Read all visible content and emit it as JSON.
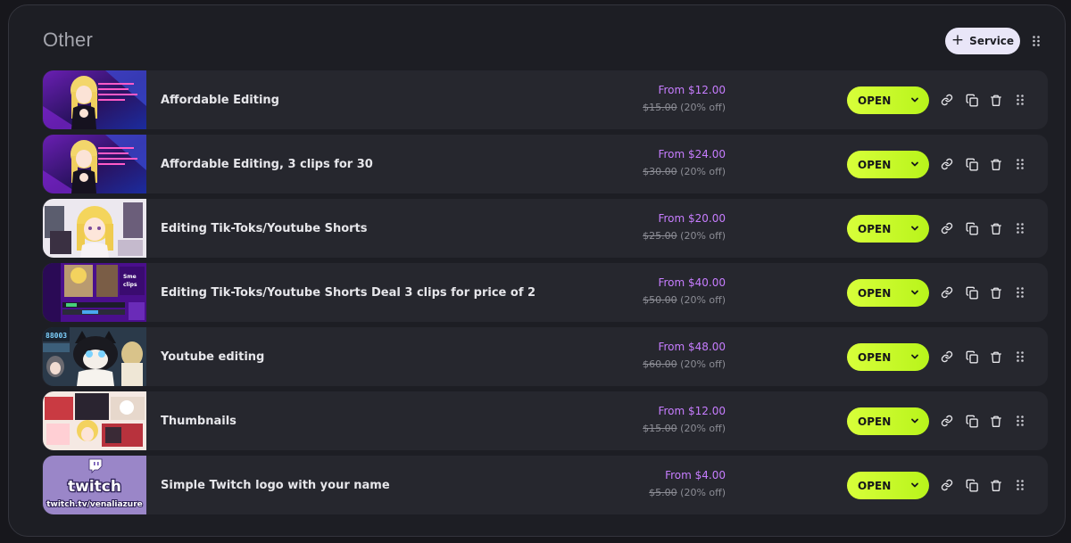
{
  "section": {
    "title": "Other",
    "add_button_label": "Service"
  },
  "colors": {
    "accent_price": "#c77dff",
    "open_button": "#c8f92a",
    "panel_bg": "#1d1e24",
    "row_bg": "#26272e"
  },
  "services": [
    {
      "name": "Affordable Editing",
      "price_from": "From $12.00",
      "price_old": "$15.00",
      "discount": "(20% off)",
      "status": "OPEN",
      "thumb": "anime-purple"
    },
    {
      "name": "Affordable Editing, 3 clips for 30",
      "price_from": "From $24.00",
      "price_old": "$30.00",
      "discount": "(20% off)",
      "status": "OPEN",
      "thumb": "anime-purple"
    },
    {
      "name": "Editing Tik-Toks/Youtube Shorts",
      "price_from": "From $20.00",
      "price_old": "$25.00",
      "discount": "(20% off)",
      "status": "OPEN",
      "thumb": "anime-collage-light"
    },
    {
      "name": "Editing Tik-Toks/Youtube Shorts Deal 3 clips for price of 2",
      "price_from": "From $40.00",
      "price_old": "$50.00",
      "discount": "(20% off)",
      "status": "OPEN",
      "thumb": "purple-collage"
    },
    {
      "name": "Youtube editing",
      "price_from": "From $48.00",
      "price_old": "$60.00",
      "discount": "(20% off)",
      "status": "OPEN",
      "thumb": "anime-cat"
    },
    {
      "name": "Thumbnails",
      "price_from": "From $12.00",
      "price_old": "$15.00",
      "discount": "(20% off)",
      "status": "OPEN",
      "thumb": "thumbnail-collage"
    },
    {
      "name": "Simple Twitch logo with your name",
      "price_from": "From $4.00",
      "price_old": "$5.00",
      "discount": "(20% off)",
      "status": "OPEN",
      "thumb": "twitch-logo",
      "thumb_text": [
        "twitch",
        "twitch.tv/venaliazure"
      ]
    }
  ]
}
